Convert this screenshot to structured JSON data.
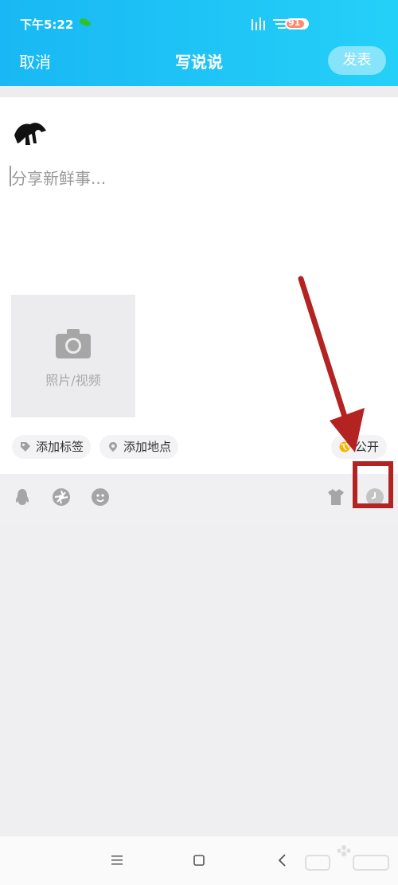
{
  "status_bar": {
    "time": "下午5:22",
    "battery": "91"
  },
  "header": {
    "cancel_label": "取消",
    "title": "写说说",
    "publish_label": "发表"
  },
  "composer": {
    "placeholder": "分享新鲜事..."
  },
  "media": {
    "label": "照片/视频"
  },
  "chips": {
    "tag_label": "添加标签",
    "location_label": "添加地点",
    "visibility_label": "公开"
  },
  "toolbar": {
    "icons": [
      "qq-penguin-icon",
      "shutter-icon",
      "emoji-icon",
      "shirt-icon",
      "clock-icon"
    ]
  },
  "colors": {
    "header_start": "#19b8f4",
    "header_end": "#24d0f8",
    "annotation": "#b32322"
  }
}
